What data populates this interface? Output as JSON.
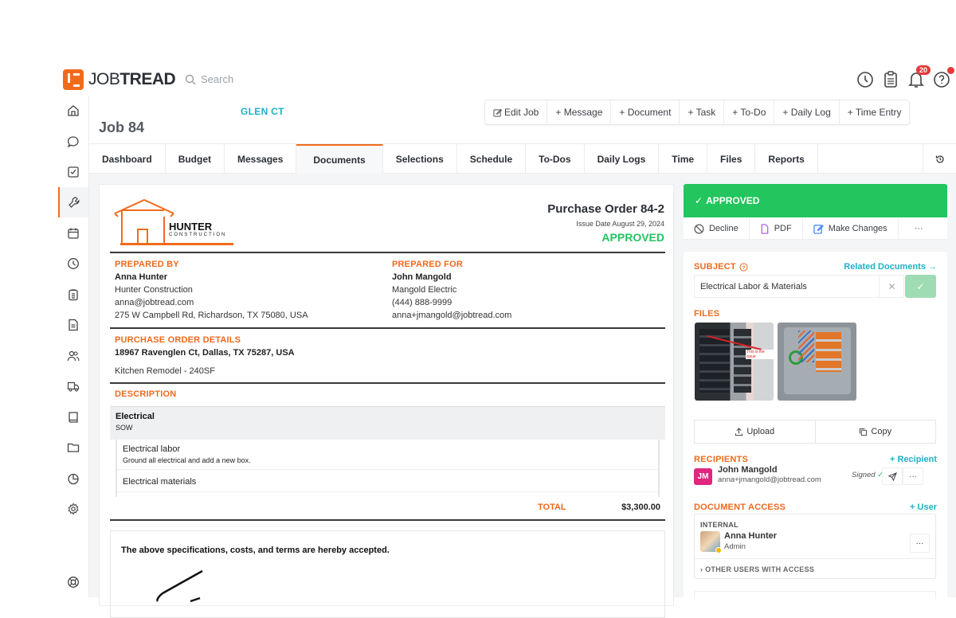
{
  "app": {
    "brand_light": "JOB",
    "brand_bold": "TREAD",
    "search_placeholder": "Search",
    "notifications_count": "20",
    "accent_color": "#f26b1d",
    "link_color": "#1fb0c7",
    "success_color": "#22c55e"
  },
  "sidebar": {
    "items": [
      {
        "icon": "home-icon"
      },
      {
        "icon": "chat-icon"
      },
      {
        "icon": "checkbox-icon"
      },
      {
        "icon": "wrench-icon",
        "active": true
      },
      {
        "icon": "calendar-icon"
      },
      {
        "icon": "clock-icon"
      },
      {
        "icon": "clipboard-icon"
      },
      {
        "icon": "document-icon"
      },
      {
        "icon": "users-icon"
      },
      {
        "icon": "truck-icon"
      },
      {
        "icon": "book-icon"
      },
      {
        "icon": "folder-icon"
      },
      {
        "icon": "pie-chart-icon"
      },
      {
        "icon": "gear-icon"
      }
    ],
    "bottom_icon": "lifebuoy-icon"
  },
  "header": {
    "job_title": "Job 84",
    "job_subtitle": "GLEN CT",
    "actions": [
      "Edit Job",
      "+ Message",
      "+ Document",
      "+ Task",
      "+ To-Do",
      "+ Daily Log",
      "+ Time Entry"
    ]
  },
  "tabs": [
    "Dashboard",
    "Budget",
    "Messages",
    "Documents",
    "Selections",
    "Schedule",
    "To-Dos",
    "Daily Logs",
    "Time",
    "Files",
    "Reports"
  ],
  "active_tab": "Documents",
  "document": {
    "company_name": "HUNTER",
    "company_sub": "CONSTRUCTION",
    "title": "Purchase Order 84-2",
    "issue_date": "Issue Date August 29, 2024",
    "status": "APPROVED",
    "prepared_by": {
      "label": "PREPARED BY",
      "name": "Anna Hunter",
      "company": "Hunter Construction",
      "email": "anna@jobtread.com",
      "address": "275 W Campbell Rd, Richardson, TX 75080, USA"
    },
    "prepared_for": {
      "label": "PREPARED FOR",
      "name": "John Mangold",
      "company": "Mangold Electric",
      "phone": "(444) 888-9999",
      "email": "anna+jmangold@jobtread.com"
    },
    "details": {
      "label": "PURCHASE ORDER DETAILS",
      "address": "18967 Ravenglen Ct, Dallas, TX 75287, USA",
      "description": "Kitchen Remodel - 240SF"
    },
    "description_label": "DESCRIPTION",
    "group": {
      "title": "Electrical",
      "subtitle": "SOW"
    },
    "line_items": [
      {
        "name": "Electrical labor",
        "note": "Ground all electrical and add a new box."
      },
      {
        "name": "Electrical materials",
        "note": ""
      }
    ],
    "total_label": "TOTAL",
    "total_value": "$3,300.00",
    "acceptance_text": "The above specifications, costs, and terms are hereby accepted."
  },
  "panel": {
    "status": "APPROVED",
    "actions": [
      "Decline",
      "PDF",
      "Make Changes",
      "···"
    ],
    "subject_label": "SUBJECT",
    "related_link": "Related Documents →",
    "subject_value": "Electrical Labor & Materials",
    "files_label": "FILES",
    "file_thumb_caption": "This is the issue",
    "upload_label": "Upload",
    "copy_label": "Copy",
    "recipients_label": "RECIPIENTS",
    "add_recipient": "+ Recipient",
    "recipient": {
      "initials": "JM",
      "name": "John Mangold",
      "email": "anna+jmangold@jobtread.com",
      "status": "Signed"
    },
    "access_label": "DOCUMENT ACCESS",
    "add_user": "+ User",
    "internal_label": "INTERNAL",
    "internal_user": {
      "name": "Anna Hunter",
      "role": "Admin"
    },
    "other_users": "OTHER USERS WITH ACCESS"
  }
}
